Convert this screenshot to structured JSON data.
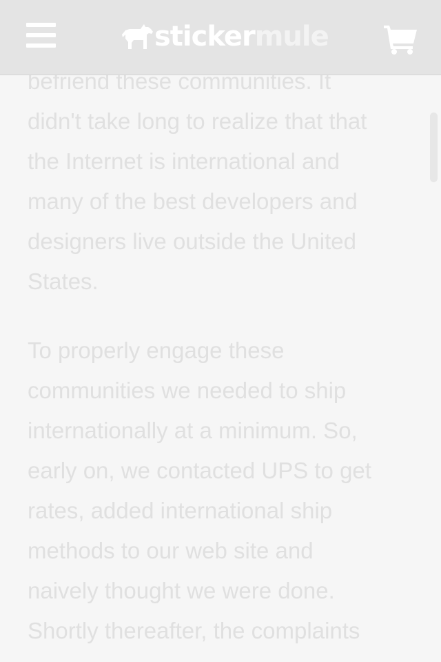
{
  "header": {
    "logo_text_a": "sticker",
    "logo_text_b": "mule",
    "menu_icon": "hamburger-menu-icon",
    "cart_icon": "shopping-cart-icon",
    "logo_icon": "mule-icon"
  },
  "article": {
    "paragraphs": [
      {
        "lines": [
          "befriend these communities. It",
          "didn't take long to realize that that",
          "the Internet is international and",
          "many of the best developers and",
          "designers live outside the United",
          "States."
        ]
      },
      {
        "lines": [
          "To properly engage these",
          "communities we needed to ship",
          "internationally at a minimum. So,",
          "early on, we contacted UPS to get",
          "rates, added international ship",
          "methods to our web site and",
          "naively thought we were done.",
          "Shortly thereafter, the complaints"
        ]
      }
    ]
  },
  "colors": {
    "background": "#f6f6f6",
    "header": "#e4e4e4",
    "text": "#e0e0e0",
    "icon": "#ffffff"
  }
}
